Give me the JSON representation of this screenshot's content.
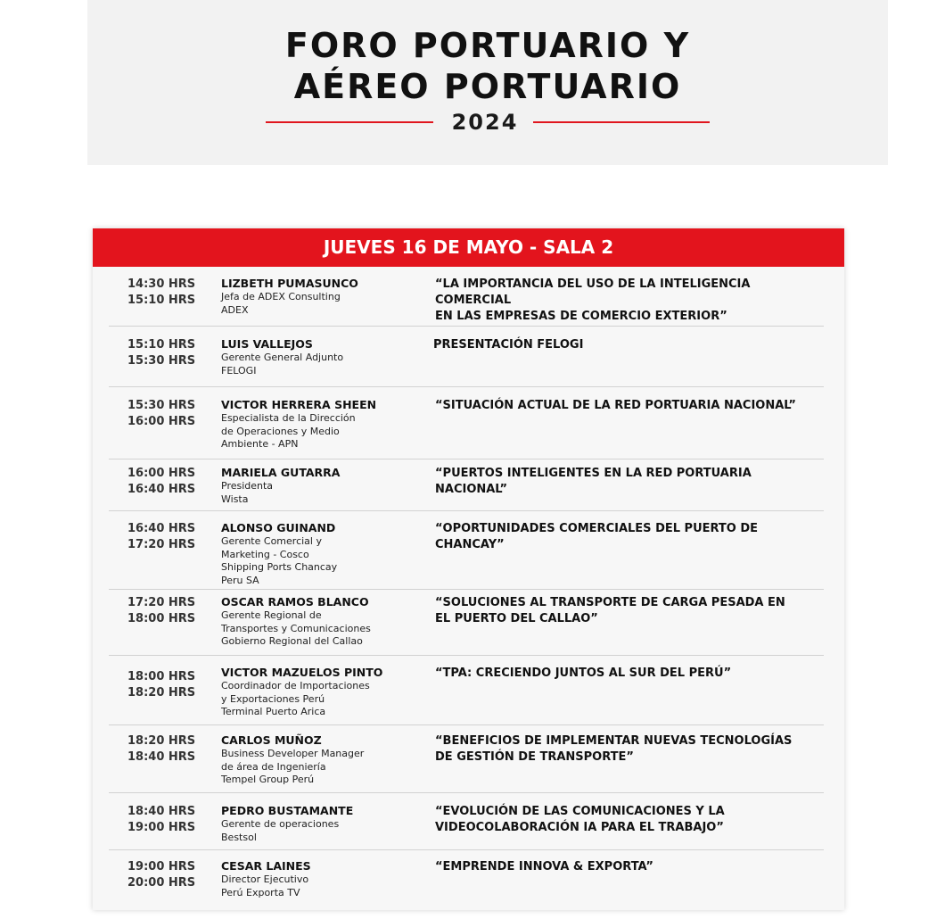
{
  "header": {
    "line1": "FORO PORTUARIO Y",
    "line2": "AÉREO PORTUARIO",
    "year": "2024",
    "accent_color": "#e3141d"
  },
  "schedule": {
    "day_label": "JUEVES 16 DE MAYO - SALA 2",
    "sessions": [
      {
        "start": "14:30 HRS",
        "end": "15:10 HRS",
        "name": "LIZBETH PUMASUNCO",
        "role": "Jefa de ADEX Consulting\nADEX",
        "topic": "“LA IMPORTANCIA DEL USO DE LA INTELIGENCIA COMERCIAL\n EN LAS EMPRESAS DE COMERCIO EXTERIOR”"
      },
      {
        "start": "15:10 HRS",
        "end": "15:30 HRS",
        "name": "LUIS VALLEJOS",
        "role": "Gerente General Adjunto\nFELOGI",
        "topic": "PRESENTACIÓN FELOGI"
      },
      {
        "start": "15:30 HRS",
        "end": "16:00 HRS",
        "name": "VICTOR HERRERA SHEEN",
        "role": "Especialista de la Dirección\nde Operaciones y Medio\nAmbiente - APN",
        "topic": "“SITUACIÓN ACTUAL DE LA RED PORTUARIA NACIONAL”"
      },
      {
        "start": "16:00 HRS",
        "end": "16:40 HRS",
        "name": "MARIELA GUTARRA",
        "role": "Presidenta\nWista",
        "topic": "“PUERTOS INTELIGENTES EN LA RED PORTUARIA NACIONAL”"
      },
      {
        "start": "16:40 HRS",
        "end": "17:20 HRS",
        "name": "ALONSO GUINAND",
        "role": "Gerente Comercial y\nMarketing - Cosco\nShipping Ports Chancay\nPeru SA",
        "topic": "“OPORTUNIDADES COMERCIALES DEL PUERTO DE CHANCAY”"
      },
      {
        "start": "17:20 HRS",
        "end": "18:00 HRS",
        "name": "OSCAR RAMOS BLANCO",
        "role": "Gerente Regional de\nTransportes y Comunicaciones\nGobierno Regional del Callao",
        "topic": "“SOLUCIONES AL TRANSPORTE DE CARGA PESADA EN\n EL PUERTO DEL CALLAO”"
      },
      {
        "start": "18:00 HRS",
        "end": "18:20 HRS",
        "name": "VICTOR MAZUELOS PINTO",
        "role": "Coordinador de Importaciones\ny Exportaciones Perú\nTerminal Puerto Arica",
        "topic": "“TPA: CRECIENDO JUNTOS AL SUR DEL PERÚ”"
      },
      {
        "start": "18:20 HRS",
        "end": "18:40 HRS",
        "name": "CARLOS MUÑOZ",
        "role": "Business Developer Manager\nde área de Ingeniería\nTempel Group Perú",
        "topic": "“BENEFICIOS DE IMPLEMENTAR NUEVAS TECNOLOGÍAS\n DE GESTIÓN DE TRANSPORTE”"
      },
      {
        "start": "18:40 HRS",
        "end": "19:00 HRS",
        "name": "PEDRO BUSTAMANTE",
        "role": "Gerente de operaciones\nBestsol",
        "topic": "“EVOLUCIÓN DE LAS COMUNICACIONES Y LA\n VIDEOCOLABORACIÓN IA PARA EL TRABAJO”"
      },
      {
        "start": "19:00 HRS",
        "end": "20:00 HRS",
        "name": "CESAR LAINES",
        "role": "Director Ejecutivo\nPerú Exporta TV",
        "topic": "“EMPRENDE INNOVA & EXPORTA”"
      }
    ]
  }
}
